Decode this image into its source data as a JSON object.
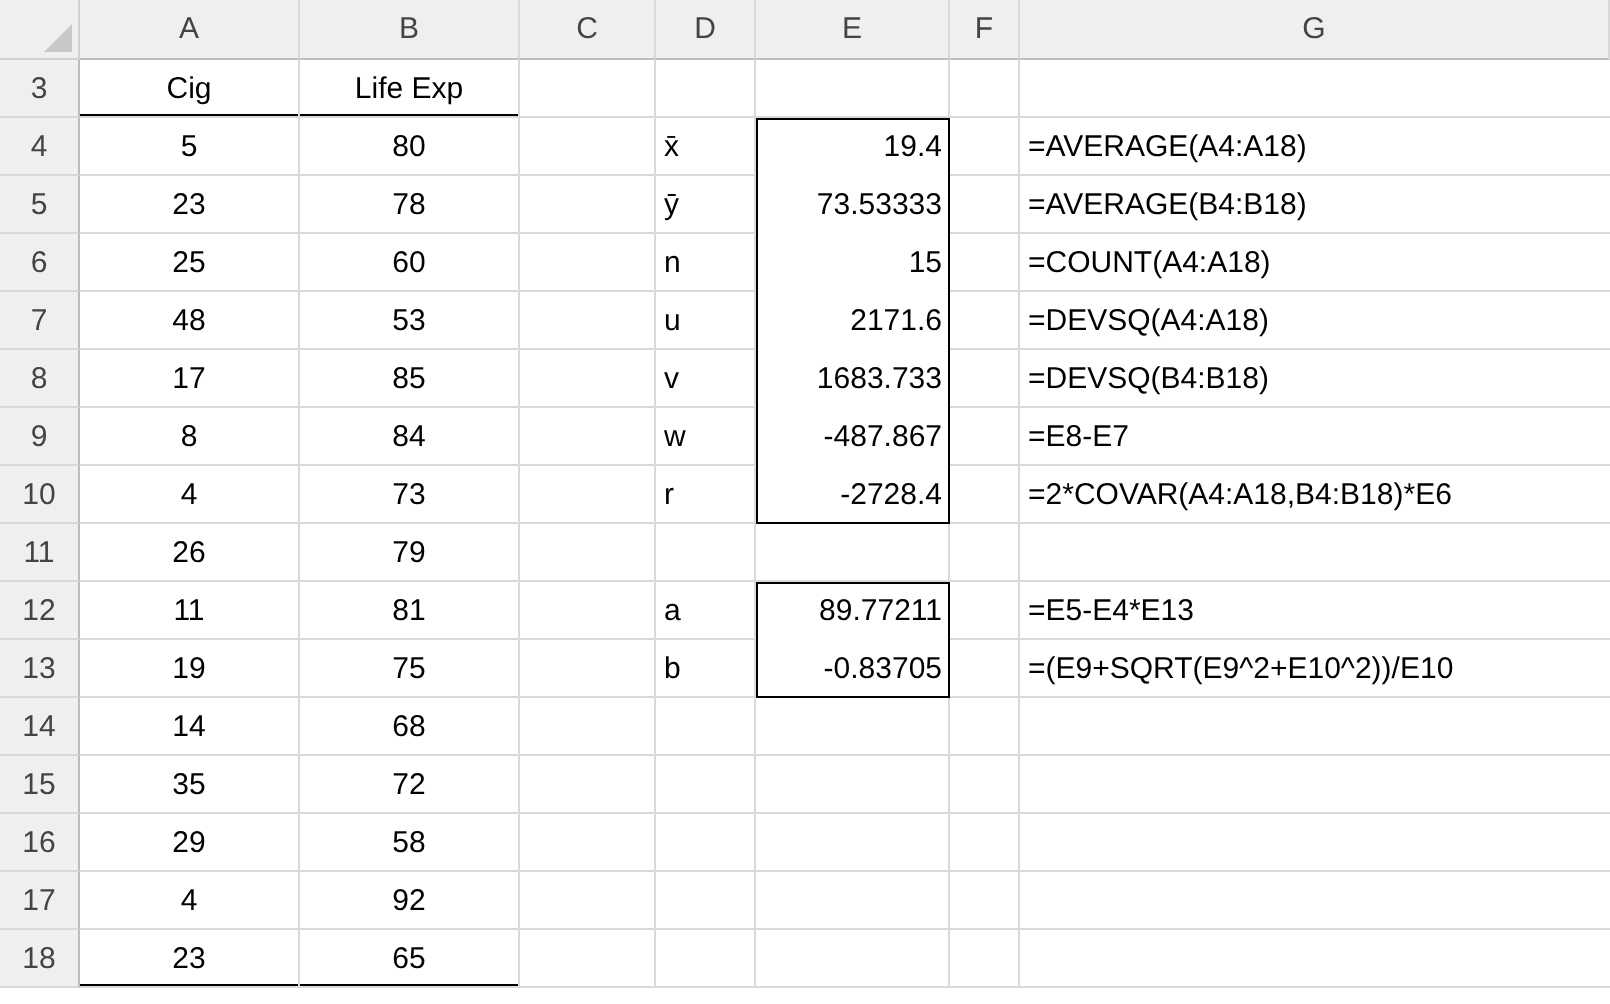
{
  "column_headers": [
    "A",
    "B",
    "C",
    "D",
    "E",
    "F",
    "G"
  ],
  "rows": [
    {
      "number": "3",
      "cells": {
        "A": {
          "text": "Cig",
          "underline": true
        },
        "B": {
          "text": "Life Exp",
          "underline": true
        }
      }
    },
    {
      "number": "4",
      "cells": {
        "A": {
          "text": "5"
        },
        "B": {
          "text": "80"
        },
        "D": {
          "text": "x̄"
        },
        "E": {
          "text": "19.4",
          "boxed": true,
          "box_top": true
        },
        "G": {
          "text": "=AVERAGE(A4:A18)"
        }
      }
    },
    {
      "number": "5",
      "cells": {
        "A": {
          "text": "23"
        },
        "B": {
          "text": "78"
        },
        "D": {
          "text": "ȳ"
        },
        "E": {
          "text": "73.53333",
          "boxed": true
        },
        "G": {
          "text": "=AVERAGE(B4:B18)"
        }
      }
    },
    {
      "number": "6",
      "cells": {
        "A": {
          "text": "25"
        },
        "B": {
          "text": "60"
        },
        "D": {
          "text": "n"
        },
        "E": {
          "text": "15",
          "boxed": true
        },
        "G": {
          "text": "=COUNT(A4:A18)"
        }
      }
    },
    {
      "number": "7",
      "cells": {
        "A": {
          "text": "48"
        },
        "B": {
          "text": "53"
        },
        "D": {
          "text": "u"
        },
        "E": {
          "text": "2171.6",
          "boxed": true
        },
        "G": {
          "text": "=DEVSQ(A4:A18)"
        }
      }
    },
    {
      "number": "8",
      "cells": {
        "A": {
          "text": "17"
        },
        "B": {
          "text": "85"
        },
        "D": {
          "text": "v"
        },
        "E": {
          "text": "1683.733",
          "boxed": true
        },
        "G": {
          "text": "=DEVSQ(B4:B18)"
        }
      }
    },
    {
      "number": "9",
      "cells": {
        "A": {
          "text": "8"
        },
        "B": {
          "text": "84"
        },
        "D": {
          "text": "w"
        },
        "E": {
          "text": "-487.867",
          "boxed": true
        },
        "G": {
          "text": "=E8-E7"
        }
      }
    },
    {
      "number": "10",
      "cells": {
        "A": {
          "text": "4"
        },
        "B": {
          "text": "73"
        },
        "D": {
          "text": "r"
        },
        "E": {
          "text": "-2728.4",
          "boxed": true,
          "underline": true
        },
        "G": {
          "text": "=2*COVAR(A4:A18,B4:B18)*E6"
        }
      }
    },
    {
      "number": "11",
      "cells": {
        "A": {
          "text": "26"
        },
        "B": {
          "text": "79"
        }
      }
    },
    {
      "number": "12",
      "cells": {
        "A": {
          "text": "11"
        },
        "B": {
          "text": "81"
        },
        "D": {
          "text": "a"
        },
        "E": {
          "text": "89.77211",
          "boxed": true,
          "box_top": true
        },
        "G": {
          "text": "=E5-E4*E13"
        }
      }
    },
    {
      "number": "13",
      "cells": {
        "A": {
          "text": "19"
        },
        "B": {
          "text": "75"
        },
        "D": {
          "text": "b"
        },
        "E": {
          "text": "-0.83705",
          "boxed": true,
          "underline": true
        },
        "G": {
          "text": "=(E9+SQRT(E9^2+E10^2))/E10"
        }
      }
    },
    {
      "number": "14",
      "cells": {
        "A": {
          "text": "14"
        },
        "B": {
          "text": "68"
        }
      }
    },
    {
      "number": "15",
      "cells": {
        "A": {
          "text": "35"
        },
        "B": {
          "text": "72"
        }
      }
    },
    {
      "number": "16",
      "cells": {
        "A": {
          "text": "29"
        },
        "B": {
          "text": "58"
        }
      }
    },
    {
      "number": "17",
      "cells": {
        "A": {
          "text": "4"
        },
        "B": {
          "text": "92"
        }
      }
    },
    {
      "number": "18",
      "cells": {
        "A": {
          "text": "23",
          "underline": true
        },
        "B": {
          "text": "65",
          "underline": true
        }
      }
    }
  ]
}
